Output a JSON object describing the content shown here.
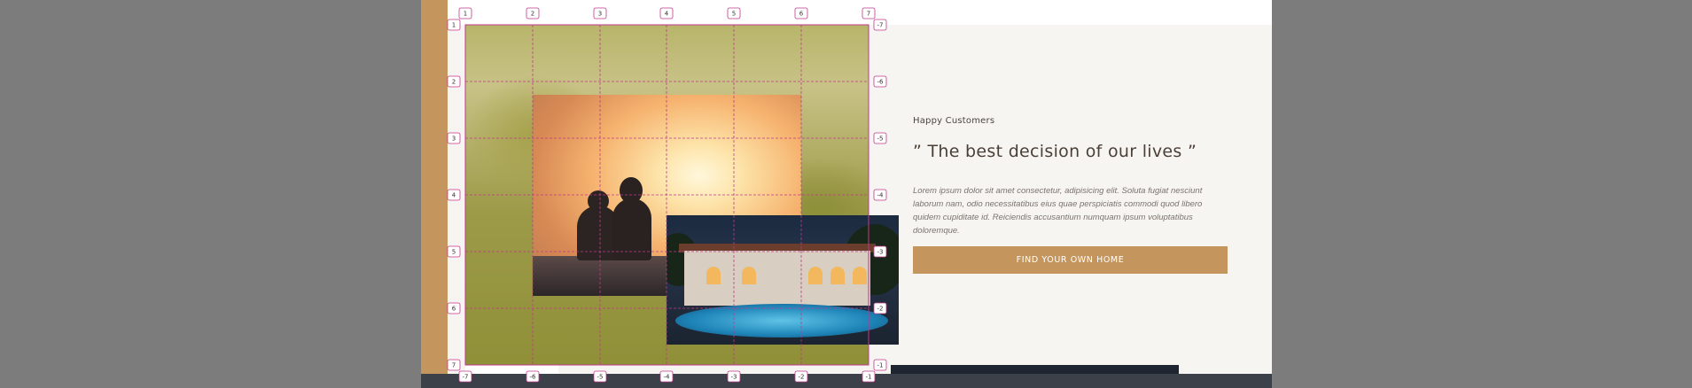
{
  "testimonial": {
    "eyebrow": "Happy Customers",
    "quote": "” The best decision of our lives ”",
    "body": "Lorem ipsum dolor sit amet consectetur, adipisicing elit. Soluta fugiat nesciunt laborum nam, odio necessitatibus eius quae perspiciatis commodi quod libero quidem cupiditate id. Reiciendis accusantium numquam ipsum voluptatibus doloremque.",
    "cta_label": "FIND YOUR OWN HOME"
  },
  "grid_overlay": {
    "color": "#c0398a",
    "top_markers": [
      "1",
      "2",
      "3",
      "4",
      "5",
      "6",
      "7"
    ],
    "bottom_markers": [
      "-7",
      "-6",
      "-5",
      "-4",
      "-3",
      "-2",
      "-1"
    ],
    "left_markers": [
      "1",
      "2",
      "3",
      "4",
      "5",
      "6",
      "7"
    ],
    "right_markers": [
      "-7",
      "-6",
      "-5",
      "-4",
      "-3",
      "-2",
      "-1"
    ]
  },
  "colors": {
    "accent": "#c4965d",
    "page_bg": "#f7f5f2",
    "heading": "#4a3f36"
  }
}
